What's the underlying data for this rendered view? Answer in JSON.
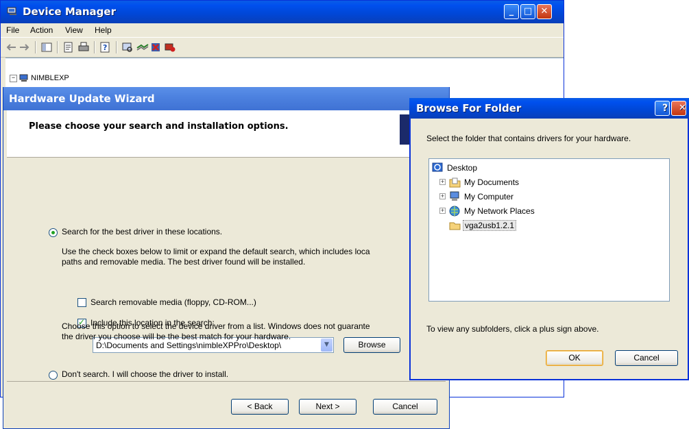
{
  "device_manager": {
    "title": "Device Manager",
    "menu": [
      "File",
      "Action",
      "View",
      "Help"
    ],
    "tree_root": "NIMBLEXP"
  },
  "wizard": {
    "title": "Hardware Update Wizard",
    "heading": "Please choose your search and installation options.",
    "opt1_label": "Search for the best driver in these locations.",
    "opt1_desc_line1": "Use the check boxes below to limit or expand the default search, which includes loca",
    "opt1_desc_line2": "paths and removable media. The best driver found will be installed.",
    "chk_removable_label": "Search removable media (floppy, CD-ROM...)",
    "chk_removable_checked": false,
    "chk_location_label": "Include this location in the search:",
    "chk_location_checked": true,
    "location_value": "D:\\Documents and Settings\\nimbleXPPro\\Desktop\\",
    "browse_label": "Browse",
    "opt2_label": "Don't search. I will choose the driver to install.",
    "opt2_desc_line1": "Choose this option to select the device driver from a list.  Windows does not guarante",
    "opt2_desc_line2": "the driver you choose will be the best match for your hardware.",
    "selected_option": "search",
    "back_label": "< Back",
    "next_label": "Next >",
    "cancel_label": "Cancel"
  },
  "browse_dialog": {
    "title": "Browse For Folder",
    "description": "Select the folder that contains drivers for your hardware.",
    "tree": [
      {
        "label": "Desktop",
        "icon": "desktop-icon",
        "expander": ""
      },
      {
        "label": "My Documents",
        "icon": "my-documents-icon",
        "expander": "+"
      },
      {
        "label": "My Computer",
        "icon": "my-computer-icon",
        "expander": "+"
      },
      {
        "label": "My Network Places",
        "icon": "network-places-icon",
        "expander": "+"
      },
      {
        "label": "vga2usb1.2.1",
        "icon": "folder-icon",
        "expander": "",
        "selected": true
      }
    ],
    "hint": "To view any subfolders, click a plus sign above.",
    "ok_label": "OK",
    "cancel_label": "Cancel"
  },
  "colors": {
    "title_bar_blue": "#0050ee",
    "inactive_title_blue": "#4d82e0",
    "dialog_face": "#ece9d8",
    "radio_dot_green": "#21a121"
  }
}
